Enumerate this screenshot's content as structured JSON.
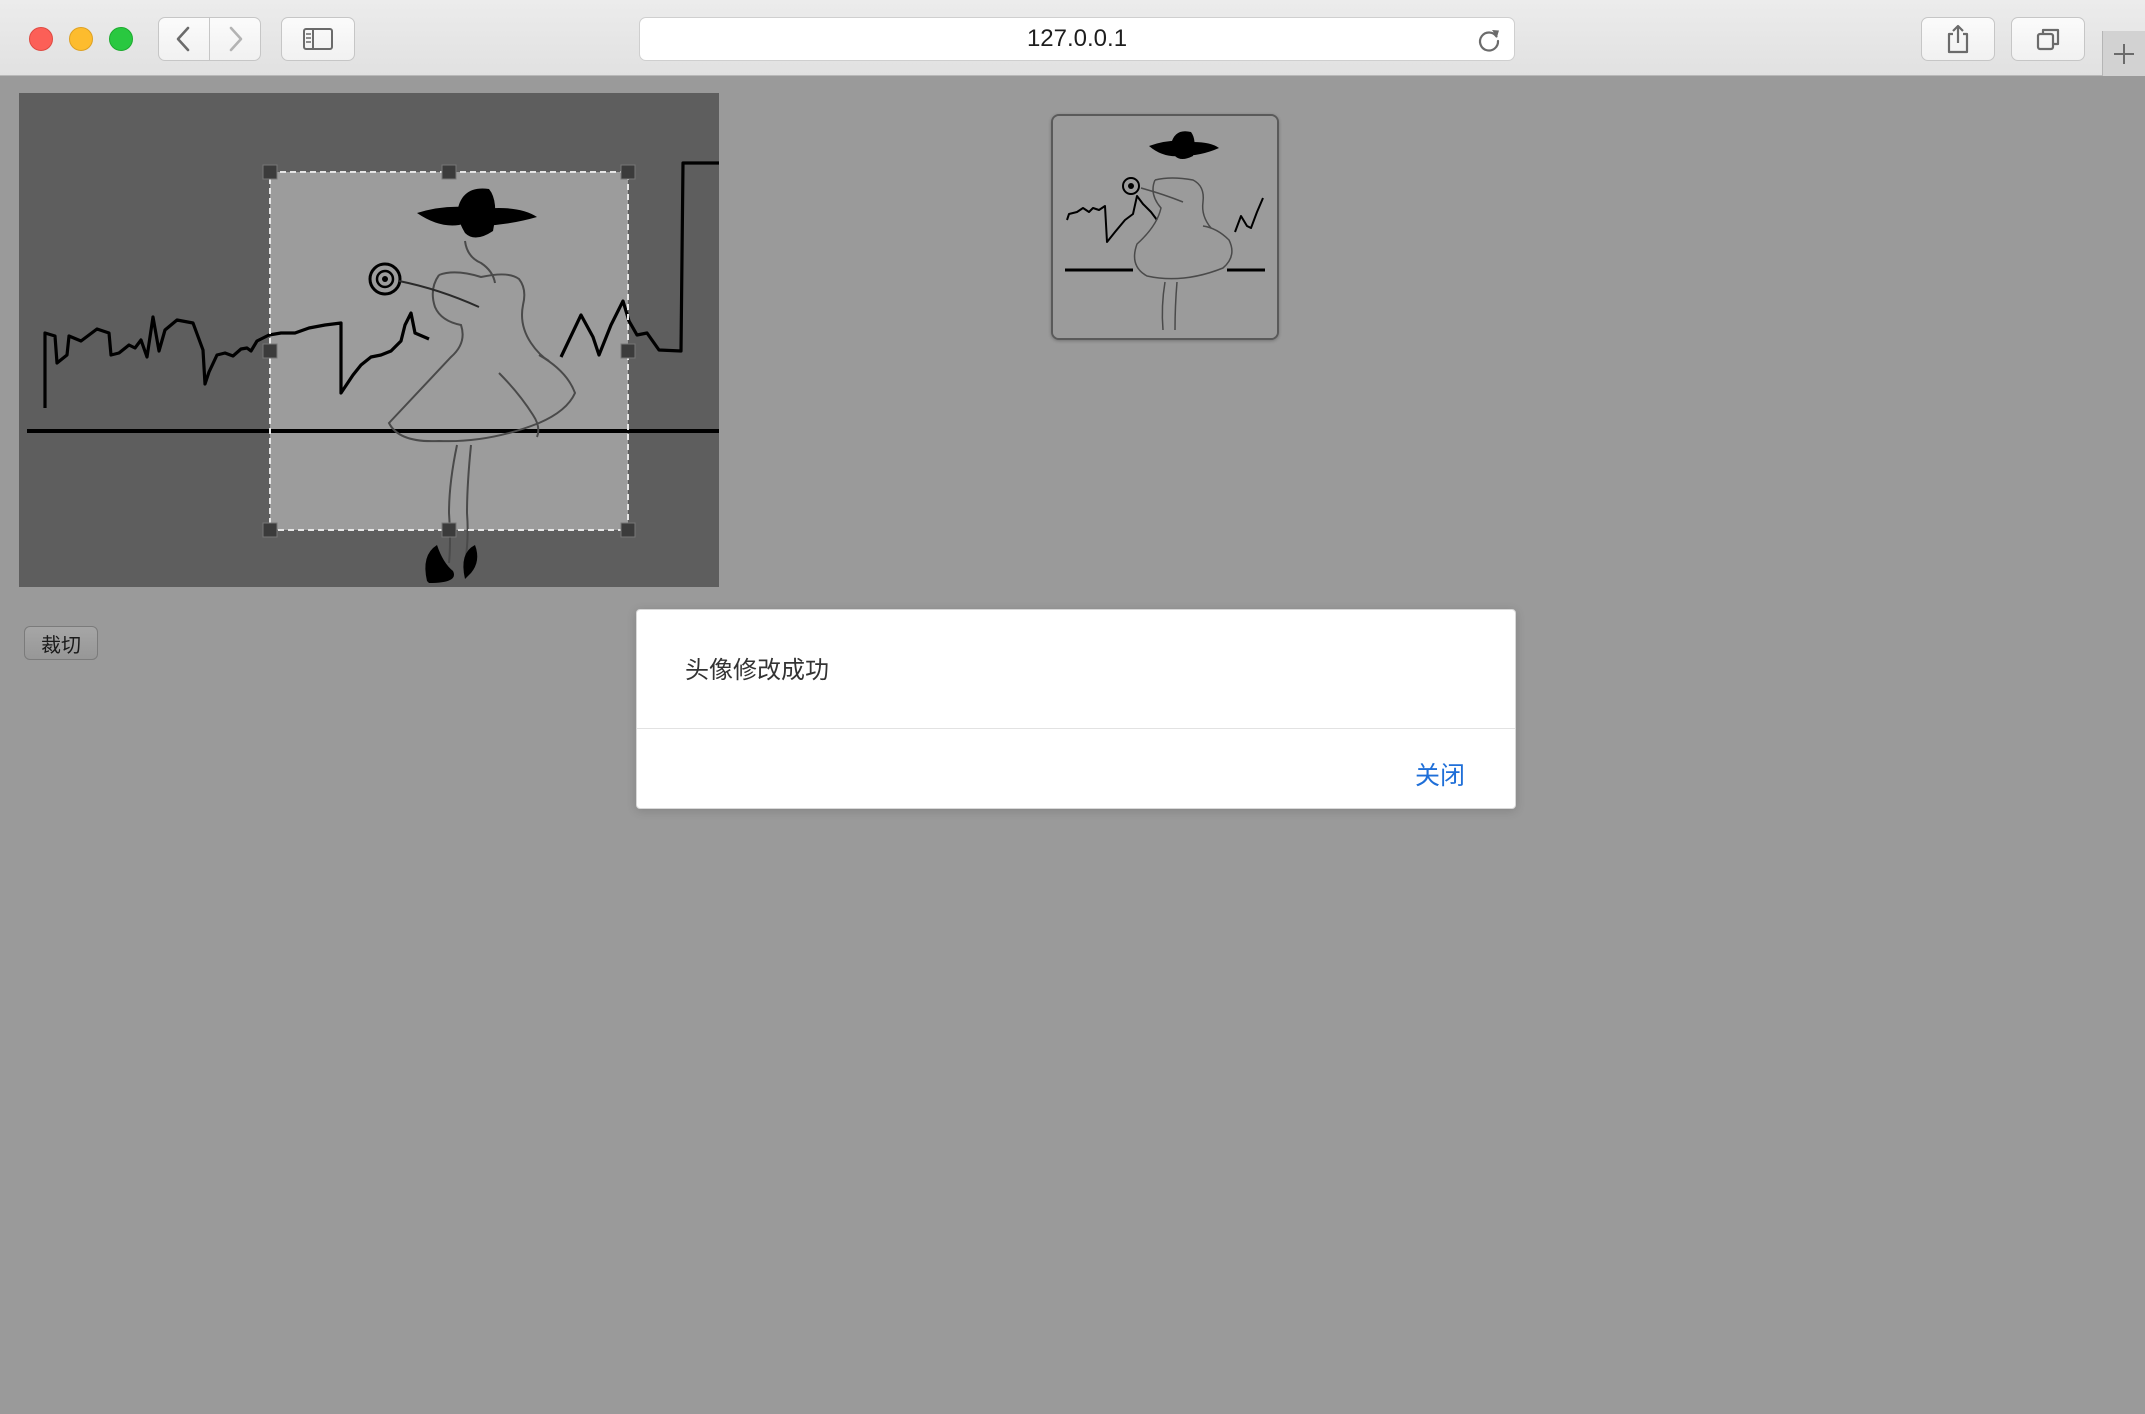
{
  "browser": {
    "url": "127.0.0.1",
    "icons": {
      "back": "chevron-left-icon",
      "forward": "chevron-right-icon",
      "sidebar": "sidebar-icon",
      "reload": "reload-icon",
      "share": "share-icon",
      "tabs": "tabs-overview-icon",
      "new_tab": "plus-icon"
    }
  },
  "page": {
    "crop_button_label": "裁切"
  },
  "modal": {
    "message": "头像修改成功",
    "close_label": "关闭",
    "accent_color": "#1f6fd8"
  }
}
